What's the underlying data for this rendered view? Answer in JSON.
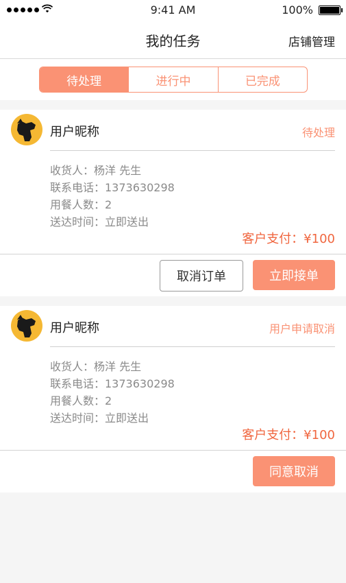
{
  "statusbar": {
    "time": "9:41 AM",
    "battery": "100%"
  },
  "nav": {
    "title": "我的任务",
    "right": "店铺管理"
  },
  "tabs": [
    {
      "label": "待处理",
      "active": true
    },
    {
      "label": "进行中",
      "active": false
    },
    {
      "label": "已完成",
      "active": false
    }
  ],
  "orders": [
    {
      "username": "用户昵称",
      "status": "待处理",
      "receiver": "收货人：杨洋 先生",
      "phone": "联系电话：1373630298",
      "diners": "用餐人数：2",
      "delivery": "送达时间：立即送出",
      "payment": "客户支付：¥100",
      "buttons": {
        "cancel": "取消订单",
        "accept": "立即接单"
      }
    },
    {
      "username": "用户昵称",
      "status": "用户申请取消",
      "receiver": "收货人：杨洋 先生",
      "phone": "联系电话：1373630298",
      "diners": "用餐人数：2",
      "delivery": "送达时间：立即送出",
      "payment": "客户支付：¥100",
      "buttons": {
        "agree": "同意取消"
      }
    }
  ],
  "colors": {
    "accent": "#fa9274",
    "payment": "#f0663f",
    "avatar_bg": "#f5b833"
  },
  "icons": {
    "avatar": "dog-avatar-icon",
    "wifi": "wifi-icon",
    "battery": "battery-icon",
    "signal": "signal-dots-icon"
  }
}
